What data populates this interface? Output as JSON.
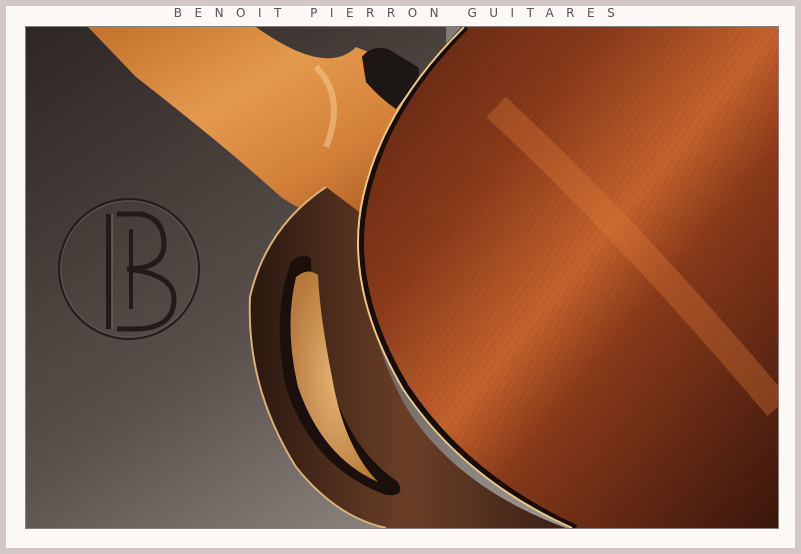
{
  "header": {
    "title": "BENOIT PIERRON GUITARES"
  },
  "photo": {
    "subject": "guitar-back-photo",
    "logo_icon": "bp-monogram-icon",
    "colors": {
      "backdrop": "#3a322f",
      "wood_back": "#8a3a1c",
      "wood_neck": "#d98a3e",
      "binding": "#e8c88a",
      "frame": "#d4c8c6"
    }
  }
}
